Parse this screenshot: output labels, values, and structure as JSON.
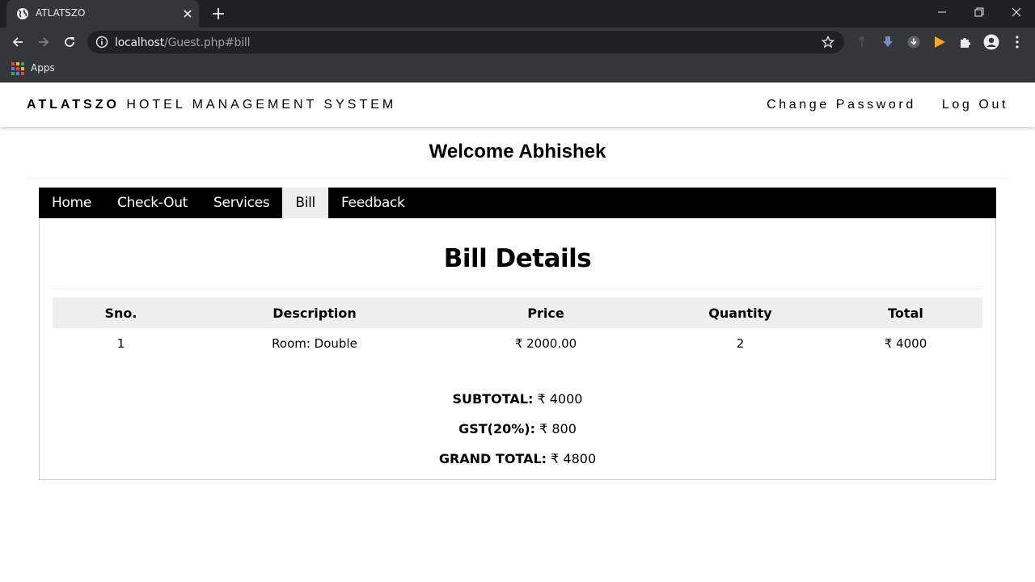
{
  "browser": {
    "tab_title": "ATLATSZO",
    "url_host": "localhost",
    "url_path": "/Guest.php#bill",
    "bookmarks": [
      {
        "label": "Apps"
      }
    ]
  },
  "header": {
    "brand_bold": "ATLATSZO",
    "brand_rest": " HOTEL MANAGEMENT SYSTEM",
    "nav": [
      "Change Password",
      "Log Out"
    ]
  },
  "welcome": "Welcome Abhishek",
  "tabs": [
    {
      "label": "Home",
      "active": false
    },
    {
      "label": "Check-Out",
      "active": false
    },
    {
      "label": "Services",
      "active": false
    },
    {
      "label": "Bill",
      "active": true
    },
    {
      "label": "Feedback",
      "active": false
    }
  ],
  "bill": {
    "title": "Bill Details",
    "columns": [
      "Sno.",
      "Description",
      "Price",
      "Quantity",
      "Total"
    ],
    "rows": [
      [
        "1",
        "Room: Double",
        "₹ 2000.00",
        "2",
        "₹ 4000"
      ]
    ],
    "subtotal_label": "SUBTOTAL:",
    "subtotal_value": " ₹ 4000",
    "gst_label": "GST(20%):",
    "gst_value": " ₹ 800",
    "grand_label": "GRAND TOTAL:",
    "grand_value": " ₹ 4800"
  },
  "colors": {
    "tabstrip": "#202124",
    "toolbar": "#35363a",
    "nav_bar": "#000000",
    "active_tab": "#eeeeee",
    "table_header": "#eeeeee"
  }
}
